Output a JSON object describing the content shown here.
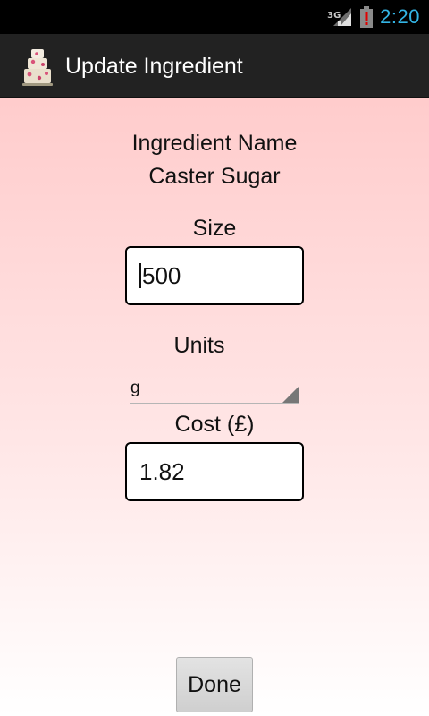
{
  "status": {
    "network_type": "3G",
    "time": "2:20",
    "signal_icon": "signal-bars-icon",
    "battery_icon": "battery-alert-icon"
  },
  "action_bar": {
    "app_icon": "wedding-cake-icon",
    "title": "Update Ingredient"
  },
  "form": {
    "ingredient_name_label": "Ingredient Name",
    "ingredient_name_value": "Caster Sugar",
    "size_label": "Size",
    "size_value": "500",
    "units_label": "Units",
    "units_selected": "g",
    "cost_label": "Cost (£)",
    "cost_value": "1.82",
    "done_label": "Done"
  },
  "colors": {
    "clock": "#33b5e5",
    "action_bar": "#222222",
    "background_top": "#ffcccc",
    "background_bottom": "#ffffff"
  }
}
